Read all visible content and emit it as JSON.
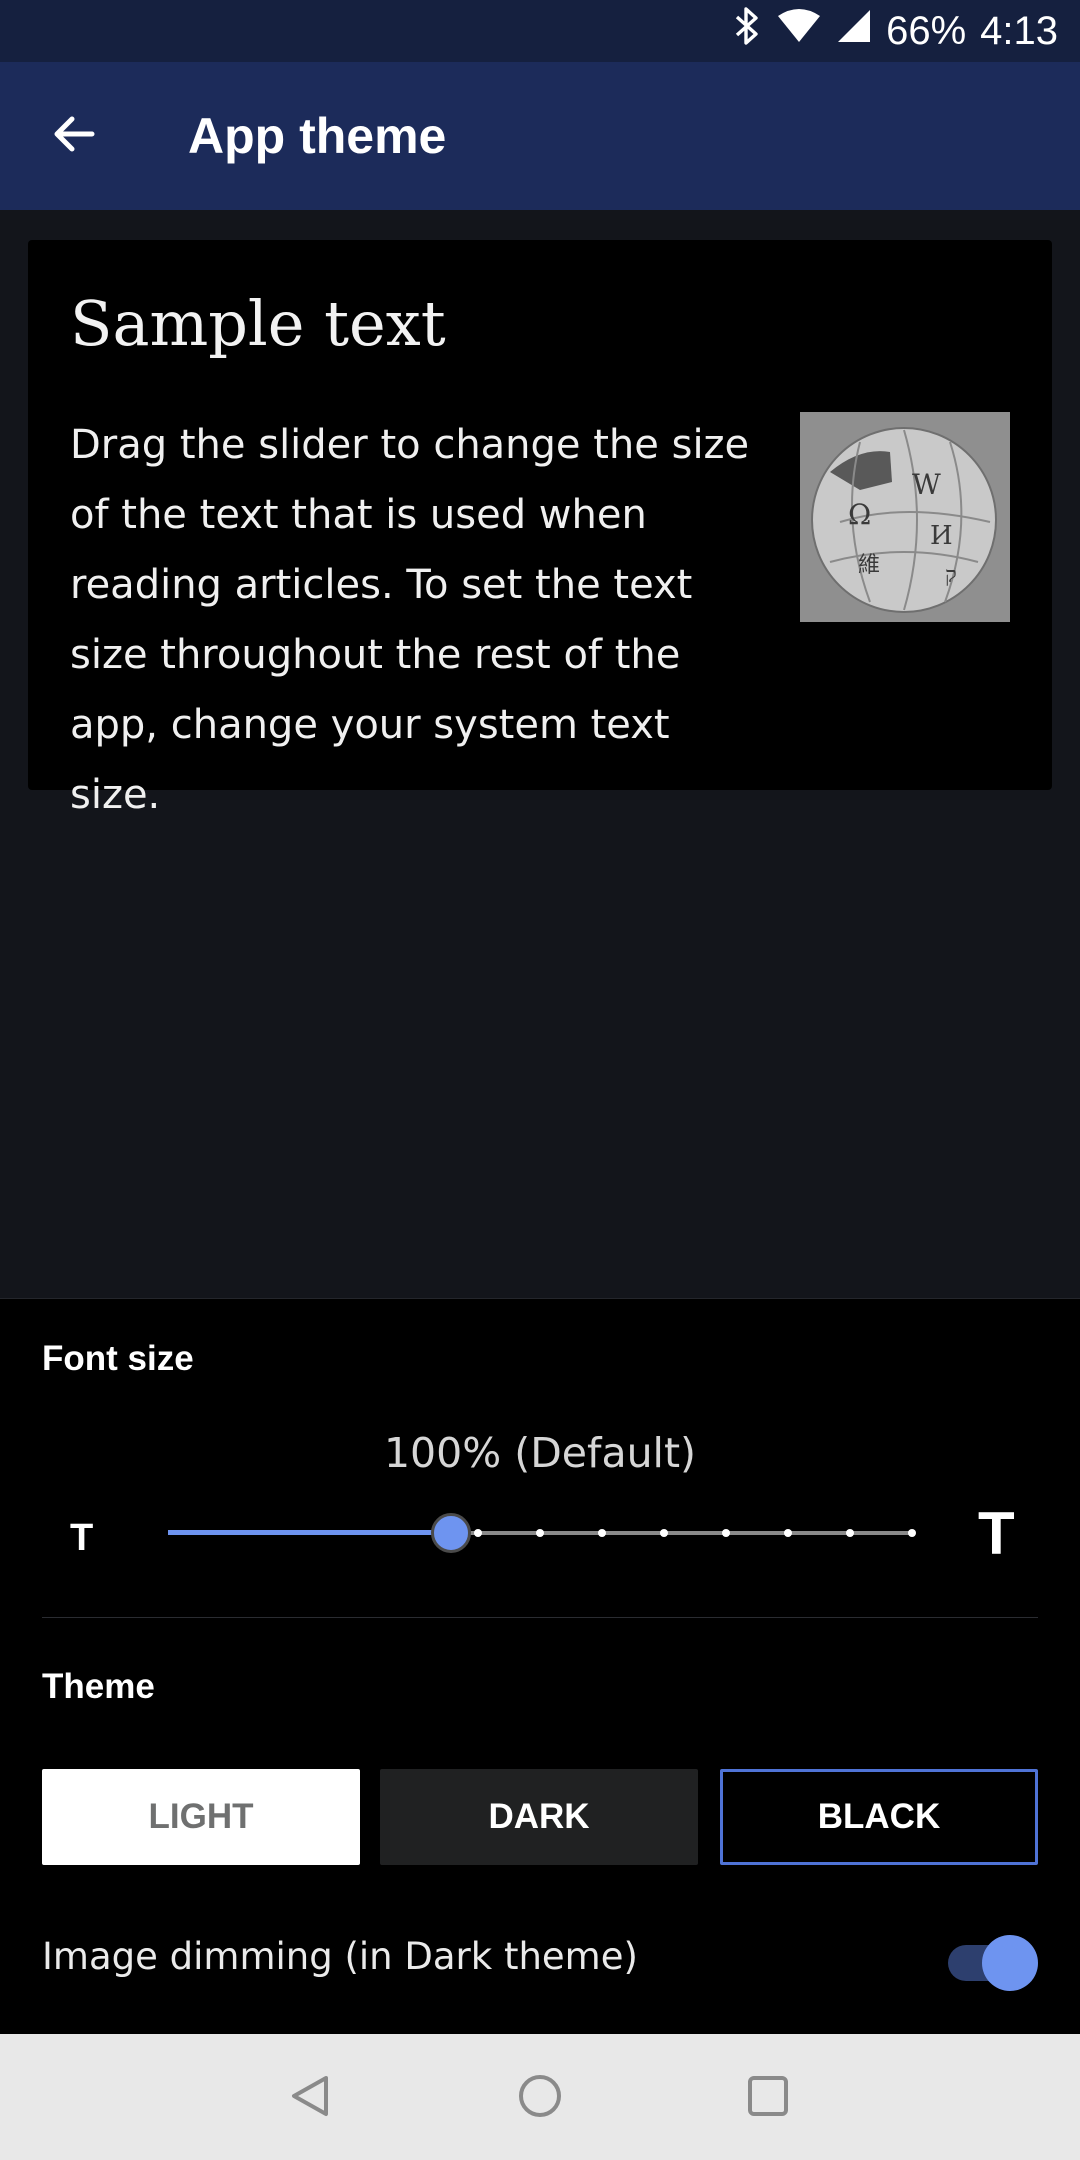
{
  "status_bar": {
    "battery": "66%",
    "time": "4:13",
    "icons": [
      "bluetooth-icon",
      "wifi-icon",
      "signal-icon"
    ]
  },
  "app_bar": {
    "title": "App theme",
    "back_icon": "arrow-left-icon"
  },
  "sample": {
    "title": "Sample text",
    "body": "Drag the slider to change the size of the text that is used when reading articles. To set the text size throughout the rest of the app, change your system text size.",
    "image_icon": "wikipedia-globe-icon"
  },
  "font_size": {
    "label": "Font size",
    "value_text": "100% (Default)",
    "small_t": "T",
    "large_t": "T",
    "slider_position": 0.38,
    "slider_steps": 13
  },
  "theme": {
    "label": "Theme",
    "options": [
      "LIGHT",
      "DARK",
      "BLACK"
    ],
    "selected": "BLACK"
  },
  "image_dimming": {
    "label": "Image dimming (in Dark theme)",
    "enabled": true
  },
  "nav_bar": {
    "icons": [
      "back-triangle-icon",
      "home-circle-icon",
      "recents-square-icon"
    ]
  },
  "colors": {
    "accent": "#6e94f0",
    "app_bar": "#1c2b5a",
    "status_bar": "#15203f"
  }
}
